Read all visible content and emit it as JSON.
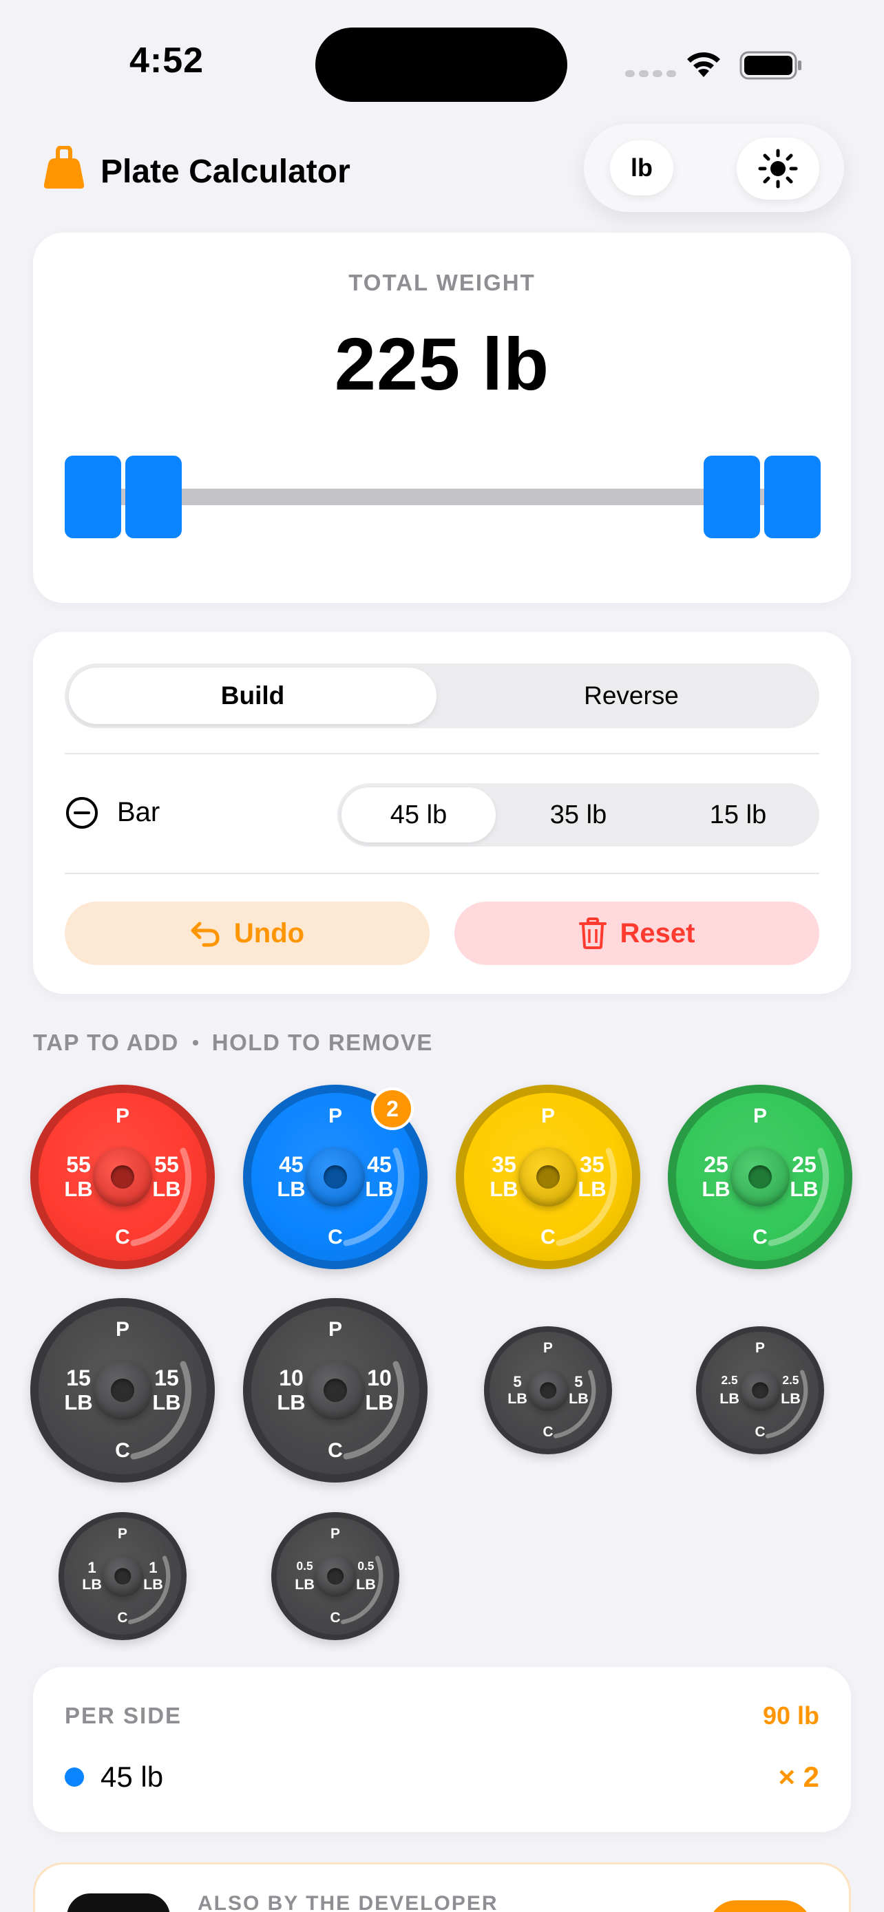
{
  "status_bar": {
    "time": "4:52"
  },
  "header": {
    "title": "Plate Calculator",
    "unit": "lb"
  },
  "total": {
    "label": "TOTAL WEIGHT",
    "value": "225 lb"
  },
  "mode": {
    "options": [
      "Build",
      "Reverse"
    ],
    "selected": "Build"
  },
  "bar": {
    "label": "Bar",
    "options": [
      "45 lb",
      "35 lb",
      "15 lb"
    ],
    "selected": "45 lb"
  },
  "actions": {
    "undo": "Undo",
    "reset": "Reset"
  },
  "hint": {
    "add": "TAP TO ADD",
    "remove": "HOLD TO REMOVE"
  },
  "plates": [
    {
      "id": "55",
      "weight": "55",
      "unit": "LB",
      "top": "P",
      "bottom": "C",
      "color": "#ff3b30"
    },
    {
      "id": "45",
      "weight": "45",
      "unit": "LB",
      "top": "P",
      "bottom": "C",
      "color": "#0a84ff",
      "count": "2"
    },
    {
      "id": "35",
      "weight": "35",
      "unit": "LB",
      "top": "P",
      "bottom": "C",
      "color": "#ffcc00"
    },
    {
      "id": "25",
      "weight": "25",
      "unit": "LB",
      "top": "P",
      "bottom": "C",
      "color": "#34c759"
    },
    {
      "id": "15",
      "weight": "15",
      "unit": "LB",
      "top": "P",
      "bottom": "C",
      "color": "#48484a"
    },
    {
      "id": "10",
      "weight": "10",
      "unit": "LB",
      "top": "P",
      "bottom": "C",
      "color": "#48484a"
    },
    {
      "id": "5",
      "weight": "5",
      "unit": "LB",
      "top": "P",
      "bottom": "C",
      "color": "#48484a"
    },
    {
      "id": "2.5",
      "weight": "2.5",
      "unit": "LB",
      "top": "P",
      "bottom": "C",
      "color": "#48484a"
    },
    {
      "id": "1",
      "weight": "1",
      "unit": "LB",
      "top": "P",
      "bottom": "C",
      "color": "#48484a"
    },
    {
      "id": "0.5",
      "weight": "0.5",
      "unit": "LB",
      "top": "P",
      "bottom": "C",
      "color": "#48484a"
    }
  ],
  "per_side": {
    "label": "PER SIDE",
    "total": "90 lb",
    "items": [
      {
        "plate": "45 lb",
        "count": "× 2",
        "color": "#0a84ff"
      }
    ]
  },
  "promo": {
    "label": "ALSO BY THE DEVELOPER"
  },
  "colors": {
    "accent": "#ff9500",
    "blue": "#0a84ff",
    "danger": "#ff3b30"
  }
}
